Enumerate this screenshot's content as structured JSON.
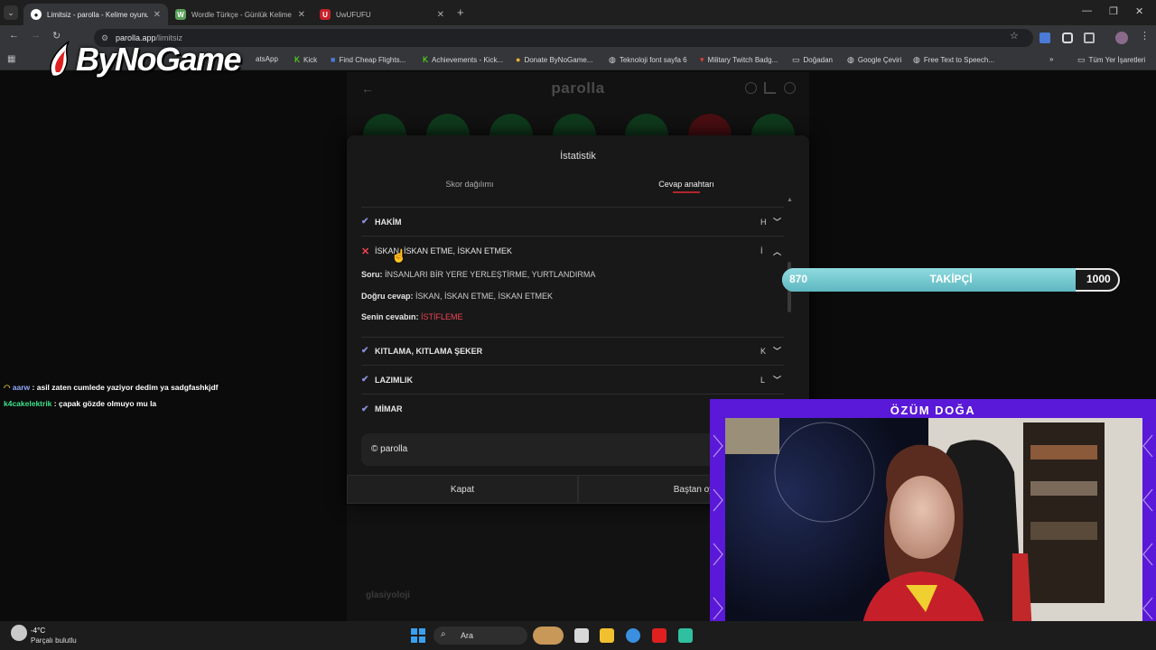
{
  "browser": {
    "tabs": [
      {
        "title": "Limitsiz - parolla - Kelime oyunu",
        "favicon": "parolla",
        "active": true
      },
      {
        "title": "Wordle Türkçe - Günlük Kelime",
        "favicon": "W",
        "active": false
      },
      {
        "title": "UwUFUFU",
        "favicon": "U",
        "active": false
      }
    ],
    "url_host": "parolla.app",
    "url_path": "/limitsiz",
    "bookmarks": [
      "atsApp",
      "Kick",
      "Find Cheap Flights...",
      "Achievements - Kick...",
      "Donate ByNoGame...",
      "Teknoloji font sayfa 6",
      "Military Twitch Badg...",
      "Doğadan",
      "Google Çeviri",
      "Free Text to Speech..."
    ],
    "all_bookmarks": "Tüm Yer İşaretleri"
  },
  "overlay_logo": "ByNoGame",
  "page": {
    "title": "parolla",
    "bottom_word": "glasiyoloji"
  },
  "modal": {
    "title": "İstatistik",
    "tabs": [
      "Skor dağılımı",
      "Cevap anahtarı"
    ],
    "rows": [
      {
        "status": "correct",
        "answer": "HAKİM",
        "letter": "H",
        "expanded": false
      },
      {
        "status": "wrong",
        "answer": "İSKAN, İSKAN ETME, İSKAN ETMEK",
        "letter": "İ",
        "expanded": true
      },
      {
        "status": "correct",
        "answer": "KITLAMA, KITLAMA ŞEKER",
        "letter": "K",
        "expanded": false
      },
      {
        "status": "correct",
        "answer": "LAZIMLIK",
        "letter": "L",
        "expanded": false
      },
      {
        "status": "correct",
        "answer": "MİMAR",
        "letter": "",
        "expanded": false
      }
    ],
    "detail": {
      "question_label": "Soru:",
      "question": "İNSANLARI BİR YERE YERLEŞTİRME, YURTLANDIRMA",
      "correct_label": "Doğru cevap:",
      "correct": "İSKAN, İSKAN ETME, İSKAN ETMEK",
      "yours_label": "Senin cevabın:",
      "yours": "İSTİFLEME"
    },
    "footer": "© parolla",
    "buttons": {
      "close": "Kapat",
      "restart": "Baştan oy"
    }
  },
  "chat": [
    {
      "user": "aarw",
      "message": ": asil zaten cumlede yaziyor dedim ya sadgfashkjdf",
      "color": "#8fa8ff"
    },
    {
      "user": "k4cakelektrik",
      "message": ": çapak gözde olmuyo mu la",
      "color": "#3ee08a"
    }
  ],
  "follower_goal": {
    "current": "870",
    "label": "TAKİPÇİ",
    "target": "1000",
    "fraction": 0.87
  },
  "webcam": {
    "name": "ÖZÜM DOĞA"
  },
  "taskbar": {
    "weather_temp": "-4°C",
    "weather_text": "Parçalı bulutlu",
    "search_label": "Ara"
  }
}
